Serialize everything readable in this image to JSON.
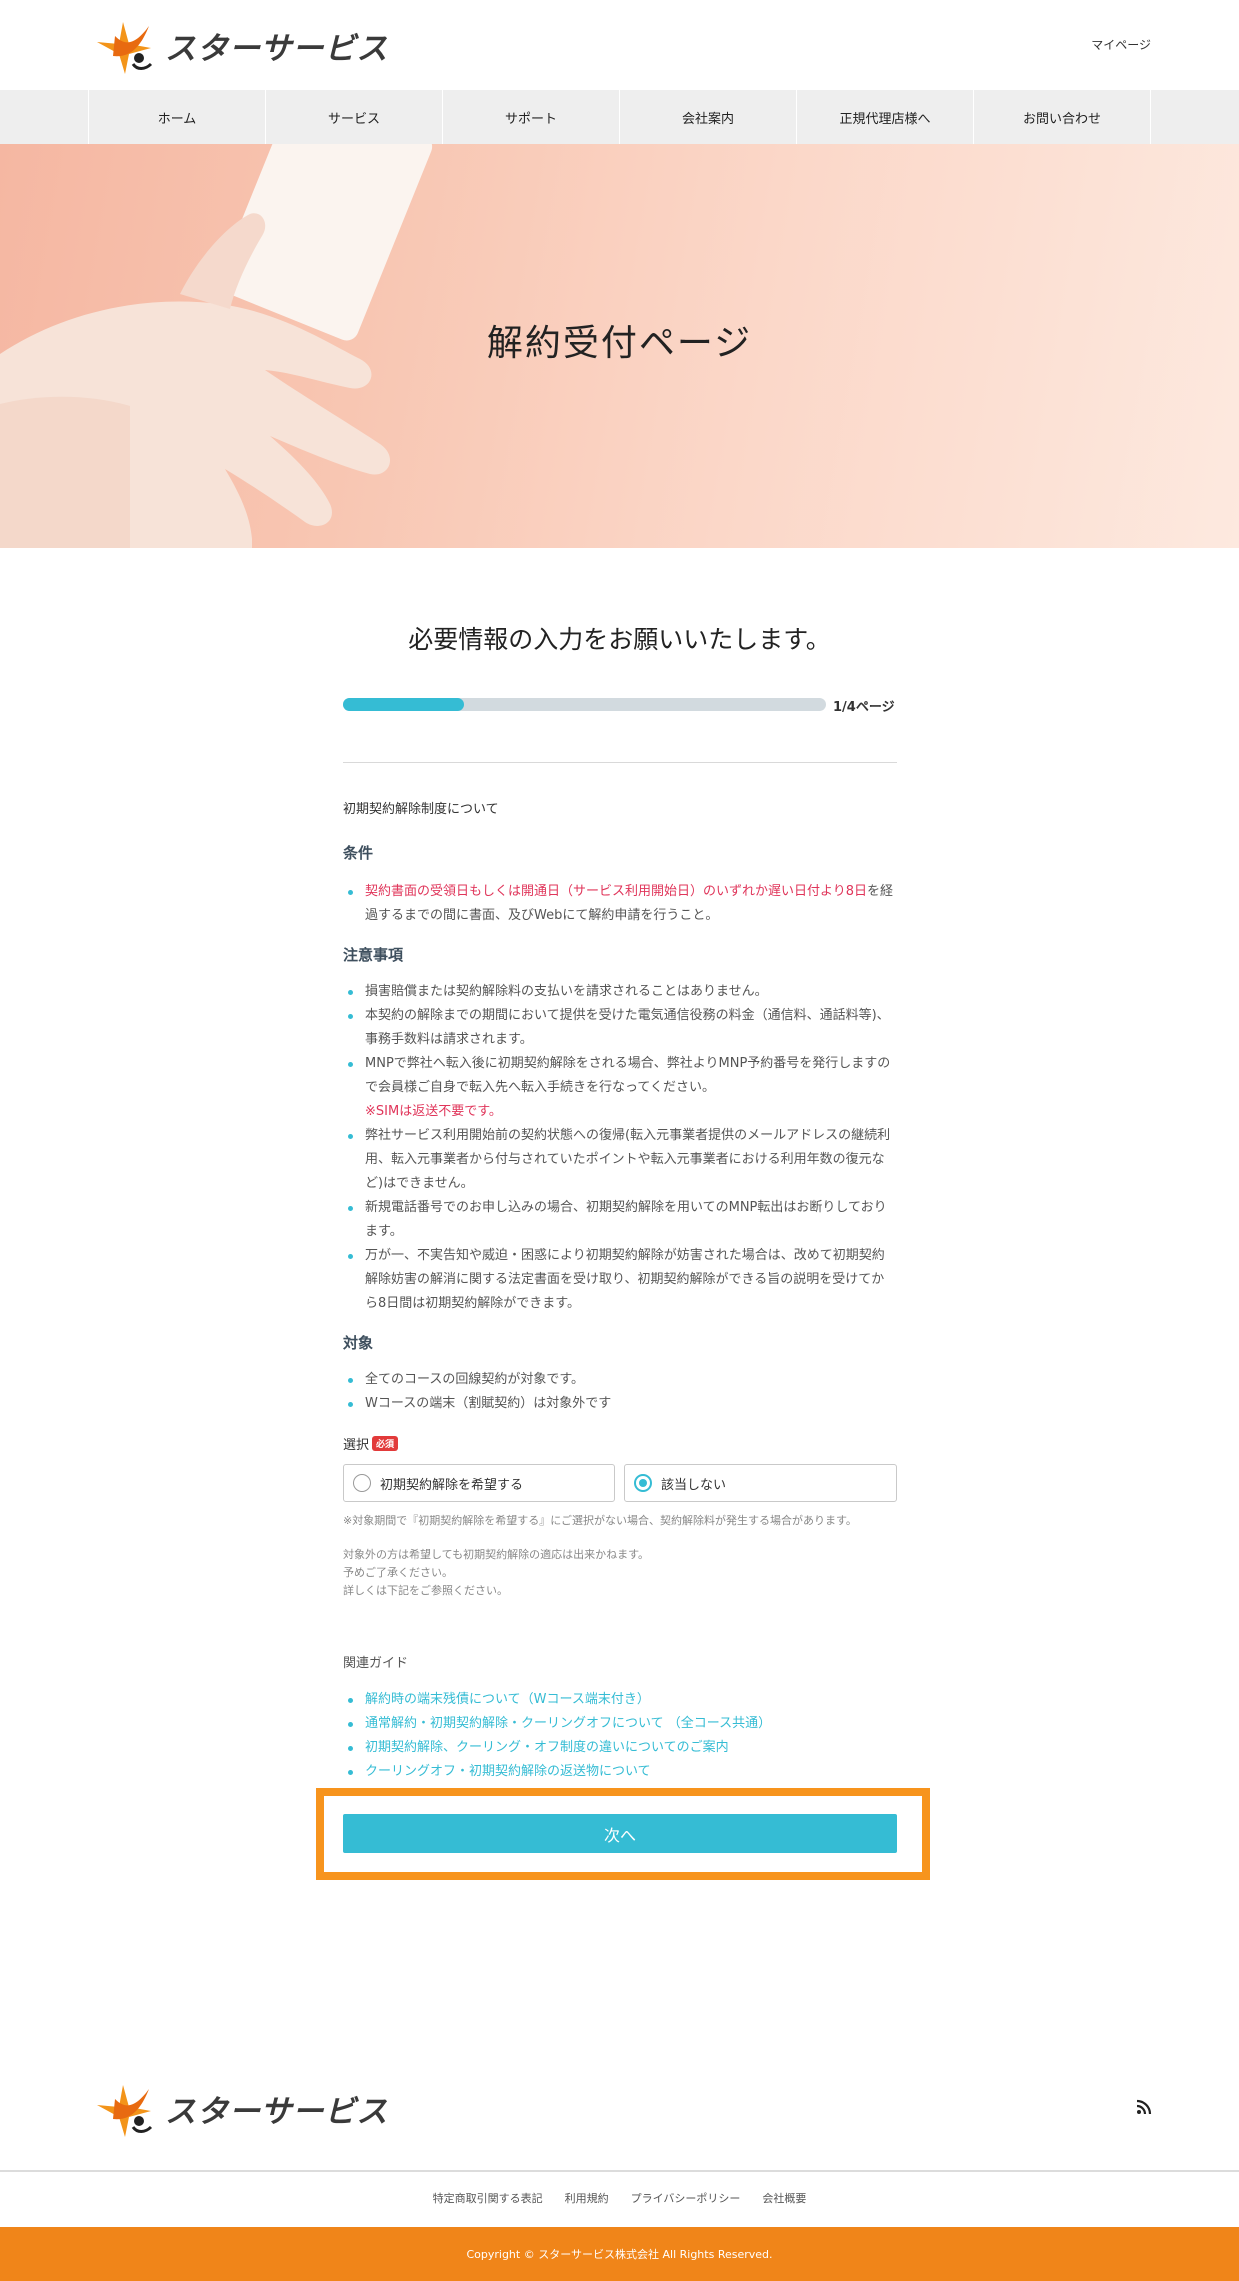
{
  "header": {
    "logo_text": "スターサービス",
    "mypage_label": "マイページ"
  },
  "nav": {
    "items": [
      {
        "label": "ホーム"
      },
      {
        "label": "サービス"
      },
      {
        "label": "サポート"
      },
      {
        "label": "会社案内"
      },
      {
        "label": "正規代理店様へ"
      },
      {
        "label": "お問い合わせ"
      }
    ]
  },
  "hero": {
    "title": "解約受付ページ"
  },
  "main": {
    "lead": "必要情報の入力をお願いいたします。",
    "progress": {
      "fraction": 0.25,
      "label": "1/4ページ"
    },
    "intro": "初期契約解除制度について",
    "conditions": {
      "title": "条件",
      "item_red": "契約書面の受領日もしくは開通日（サービス利用開始日）のいずれか遅い日付より8日",
      "item_rest": "を経過するまでの間に書面、及びWebにて解約申請を行うこと。"
    },
    "notes": {
      "title": "注意事項",
      "items": [
        "損害賠償または契約解除料の支払いを請求されることはありません。",
        "本契約の解除までの期間において提供を受けた電気通信役務の料金（通信料、通話料等)、事務手数料は請求されます。",
        "MNPで弊社へ転入後に初期契約解除をされる場合、弊社よりMNP予約番号を発行しますので会員様ご自身で転入先へ転入手続きを行なってください。",
        "弊社サービス利用開始前の契約状態への復帰(転入元事業者提供のメールアドレスの継続利用、転入元事業者から付与されていたポイントや転入元事業者における利用年数の復元など)はできません。",
        "新規電話番号でのお申し込みの場合、初期契約解除を用いてのMNP転出はお断りしております。",
        "万が一、不実告知や威迫・困惑により初期契約解除が妨害された場合は、改めて初期契約解除妨害の解消に関する法定書面を受け取り、初期契約解除ができる旨の説明を受けてから8日間は初期契約解除ができます。"
      ],
      "sim_note": "※SIMは返送不要です。"
    },
    "target": {
      "title": "対象",
      "items": [
        "全てのコースの回線契約が対象です。",
        "Wコースの端末（割賦契約）は対象外です"
      ]
    },
    "selection": {
      "label": "選択",
      "required_badge": "必須",
      "options": [
        {
          "label": "初期契約解除を希望する",
          "selected": false
        },
        {
          "label": "該当しない",
          "selected": true
        }
      ],
      "note1": "※対象期間で『初期契約解除を希望する』にご選択がない場合、契約解除料が発生する場合があります。",
      "note2_lines": [
        "対象外の方は希望しても初期契約解除の適応は出来かねます。",
        "予めご了承ください。",
        "詳しくは下記をご参照ください。"
      ]
    },
    "guide": {
      "title": "関連ガイド",
      "links": [
        "解約時の端末残債について（Wコース端末付き）",
        "通常解約・初期契約解除・クーリングオフについて （全コース共通）",
        "初期契約解除、クーリング・オフ制度の違いについてのご案内",
        "クーリングオフ・初期契約解除の返送物について"
      ]
    },
    "next_label": "次へ"
  },
  "footer": {
    "logo_text": "スターサービス",
    "links": [
      "特定商取引関する表記",
      "利用規約",
      "プライバシーポリシー",
      "会社概要"
    ],
    "copyright": "Copyright © スターサービス株式会社 All Rights Reserved."
  },
  "colors": {
    "accent": "#35bcd4",
    "highlight": "#f7941d",
    "footer_bar": "#f08519",
    "red": "#e0355a"
  }
}
